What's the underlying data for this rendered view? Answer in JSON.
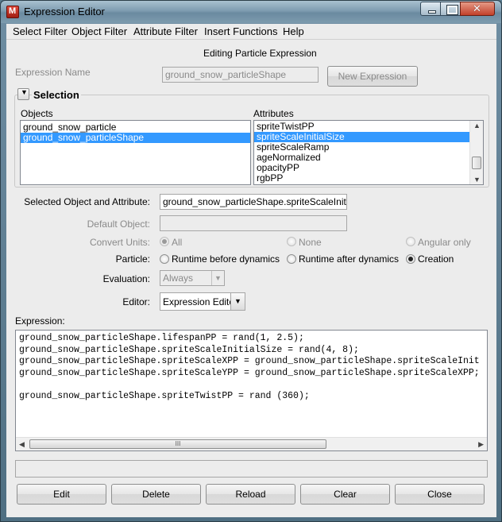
{
  "window": {
    "title": "Expression Editor"
  },
  "menu": [
    "Select Filter",
    "Object Filter",
    "Attribute Filter",
    "Insert Functions",
    "Help"
  ],
  "header": {
    "editing_label": "Editing Particle Expression"
  },
  "expression_name": {
    "label": "Expression Name",
    "value": "ground_snow_particleShape",
    "new_button": "New Expression"
  },
  "selection": {
    "title": "Selection",
    "objects_label": "Objects",
    "attributes_label": "Attributes",
    "objects": [
      "ground_snow_particle",
      "ground_snow_particleShape"
    ],
    "objects_selected": 1,
    "attributes": [
      "spriteTwistPP",
      "spriteScaleInitialSize",
      "spriteScaleRamp",
      "ageNormalized",
      "opacityPP",
      "rgbPP"
    ],
    "attributes_selected": 1
  },
  "selected_obj_attr": {
    "label": "Selected Object and Attribute:",
    "value": "ground_snow_particleShape.spriteScaleInitialSize"
  },
  "default_object": {
    "label": "Default Object:",
    "value": ""
  },
  "convert_units": {
    "label": "Convert Units:",
    "options": [
      "All",
      "None",
      "Angular only"
    ],
    "selected": "All"
  },
  "particle": {
    "label": "Particle:",
    "options": [
      "Runtime before dynamics",
      "Runtime after dynamics",
      "Creation"
    ],
    "selected": "Creation"
  },
  "evaluation": {
    "label": "Evaluation:",
    "value": "Always"
  },
  "editor": {
    "label": "Editor:",
    "value": "Expression Editor"
  },
  "expression": {
    "label": "Expression:",
    "lines": [
      "ground_snow_particleShape.lifespanPP = rand(1, 2.5);",
      "ground_snow_particleShape.spriteScaleInitialSize = rand(4, 8);",
      "ground_snow_particleShape.spriteScaleXPP = ground_snow_particleShape.spriteScaleInit",
      "ground_snow_particleShape.spriteScaleYPP = ground_snow_particleShape.spriteScaleXPP;",
      "",
      "ground_snow_particleShape.spriteTwistPP = rand (360);"
    ],
    "hscroll_grip": "III"
  },
  "status_text": "",
  "buttons": {
    "edit": "Edit",
    "delete": "Delete",
    "reload": "Reload",
    "clear": "Clear",
    "close": "Close"
  }
}
